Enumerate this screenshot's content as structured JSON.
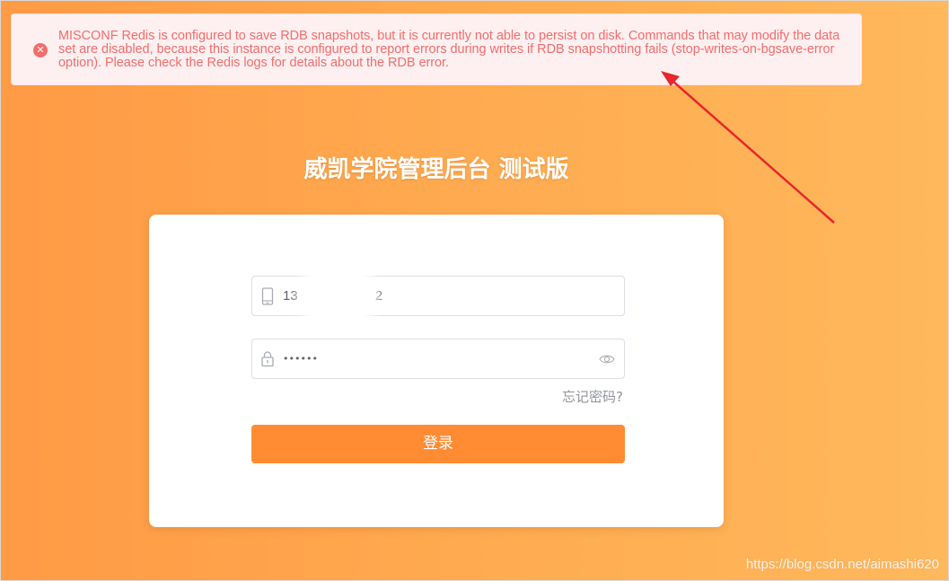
{
  "alert": {
    "type": "error",
    "icon": "error-circle-icon",
    "message": "MISCONF Redis is configured to save RDB snapshots, but it is currently not able to persist on disk. Commands that may modify the data set are disabled, because this instance is configured to report errors during writes if RDB snapshotting fails (stop-writes-on-bgsave-error option). Please check the Redis logs for details about the RDB error."
  },
  "header": {
    "title": "威凯学院管理后台 测试版"
  },
  "login_form": {
    "phone": {
      "icon": "mobile-phone-icon",
      "value_start": "13",
      "value_end": "2"
    },
    "password": {
      "icon": "lock-icon",
      "value": "••••••",
      "toggle_icon": "eye-icon"
    },
    "forgot_password_label": "忘记密码?",
    "submit_label": "登录"
  },
  "watermark": "https://blog.csdn.net/aimashi620",
  "colors": {
    "background_start": "#ff9a45",
    "background_end": "#ffb85c",
    "alert_text": "#f56c6c",
    "alert_background": "#fef0f0",
    "button": "#ff8c33",
    "annotation_arrow": "#e8262b"
  }
}
